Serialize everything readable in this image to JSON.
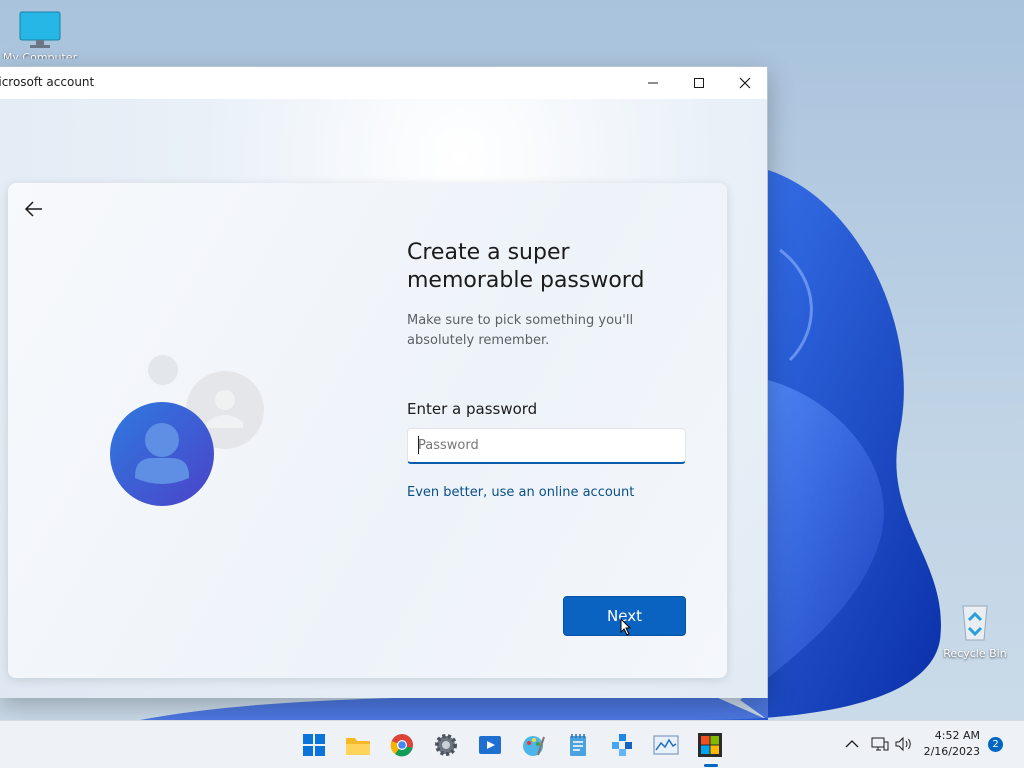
{
  "desktop": {
    "icons": [
      {
        "label": "My Computer",
        "icon": "monitor-icon"
      },
      {
        "label": "Recycle Bin",
        "icon": "recycle-bin-icon"
      }
    ]
  },
  "window": {
    "title": "Microsoft account",
    "controls": {
      "minimize": "minimize-icon",
      "maximize": "maximize-icon",
      "close": "close-icon"
    }
  },
  "page": {
    "back_icon": "arrow-left-icon",
    "heading": "Create a super memorable password",
    "subtitle": "Make sure to pick something you'll absolutely remember.",
    "field_label": "Enter a password",
    "password": {
      "value": "",
      "placeholder": "Password"
    },
    "alt_link": "Even better, use an online account",
    "next_label": "Next"
  },
  "taskbar": {
    "apps": [
      "start-icon",
      "file-explorer-icon",
      "chrome-icon",
      "settings-icon",
      "media-player-icon",
      "paint-icon",
      "notepad-icon",
      "network-tool-icon",
      "performance-monitor-icon",
      "microsoft-store-icon"
    ],
    "active_app": "microsoft-store-icon",
    "time": "4:52 AM",
    "date": "2/16/2023",
    "notification_count": "2"
  },
  "colors": {
    "accent": "#0b63c1",
    "link": "#0a4f8a",
    "avatar": "#2f5fd0"
  }
}
